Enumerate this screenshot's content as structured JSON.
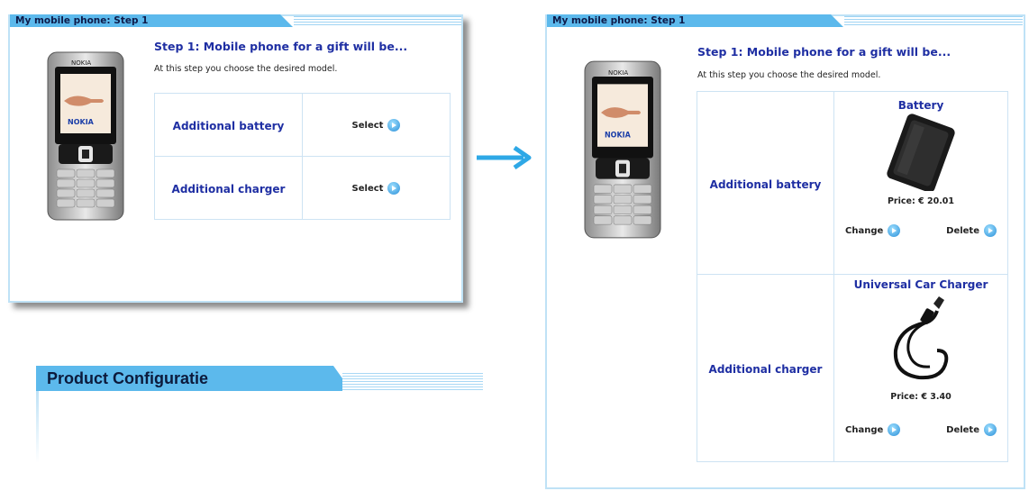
{
  "left_panel": {
    "tab_title": "My mobile phone: Step 1",
    "heading": "Step 1: Mobile phone for a gift will be...",
    "subtext": "At this step you choose the desired model.",
    "options": [
      {
        "label": "Additional battery",
        "action": "Select"
      },
      {
        "label": "Additional charger",
        "action": "Select"
      }
    ]
  },
  "right_panel": {
    "tab_title": "My mobile phone: Step 1",
    "heading": "Step 1: Mobile phone for a gift will be...",
    "subtext": "At this step you choose the desired model.",
    "options": [
      {
        "label": "Additional battery",
        "product": "Battery",
        "price": "Price: € 20.01",
        "change": "Change",
        "delete": "Delete"
      },
      {
        "label": "Additional charger",
        "product": "Universal Car Charger",
        "price": "Price: € 3.40",
        "change": "Change",
        "delete": "Delete"
      }
    ]
  },
  "phone_brand": "NOKIA",
  "config": {
    "title": "Product Configuratie"
  },
  "colors": {
    "accent": "#5cb9ec",
    "heading": "#1f2fa3",
    "border": "#bfe2f6",
    "arrow": "#2ea8e6"
  }
}
